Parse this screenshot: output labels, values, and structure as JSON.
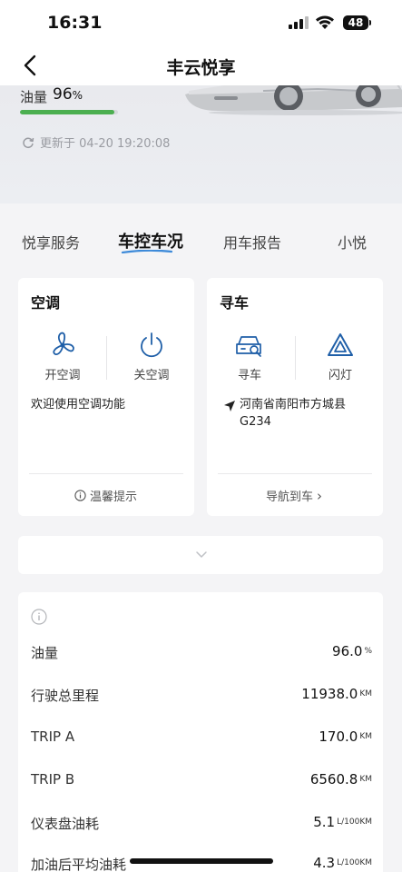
{
  "status_bar": {
    "time": "16:31",
    "battery": "48"
  },
  "nav": {
    "title": "丰云悦享"
  },
  "hero": {
    "oil_label": "油量",
    "oil_value": "96",
    "oil_unit": "%",
    "oil_fraction": 0.96,
    "update_text": "更新于 04-20 19:20:08"
  },
  "tabs": [
    {
      "label": "悦享服务"
    },
    {
      "label": "车控车况"
    },
    {
      "label": "用车报告"
    },
    {
      "label": "小悦"
    }
  ],
  "ac_card": {
    "title": "空调",
    "on_label": "开空调",
    "off_label": "关空调",
    "message": "欢迎使用空调功能",
    "footer": "温馨提示"
  },
  "find_card": {
    "title": "寻车",
    "find_label": "寻车",
    "flash_label": "闪灯",
    "location_line1": "河南省南阳市方城县",
    "location_line2": "G234",
    "footer": "导航到车",
    "footer_arrow": "›"
  },
  "expand": {
    "icon": "chevron-down-icon"
  },
  "stats": [
    {
      "label": "油量",
      "value": "96.0",
      "unit": "%"
    },
    {
      "label": "行驶总里程",
      "value": "11938.0",
      "unit": "KM"
    },
    {
      "label": "TRIP A",
      "value": "170.0",
      "unit": "KM"
    },
    {
      "label": "TRIP B",
      "value": "6560.8",
      "unit": "KM"
    },
    {
      "label": "仪表盘油耗",
      "value": "5.1",
      "unit": "L/100KM"
    },
    {
      "label": "加油后平均油耗",
      "value": "4.3",
      "unit": "L/100KM"
    }
  ],
  "colors": {
    "accent_blue": "#1f5fa8",
    "oil_green": "#4caf50",
    "tab_underline": "#3d8ad9"
  }
}
